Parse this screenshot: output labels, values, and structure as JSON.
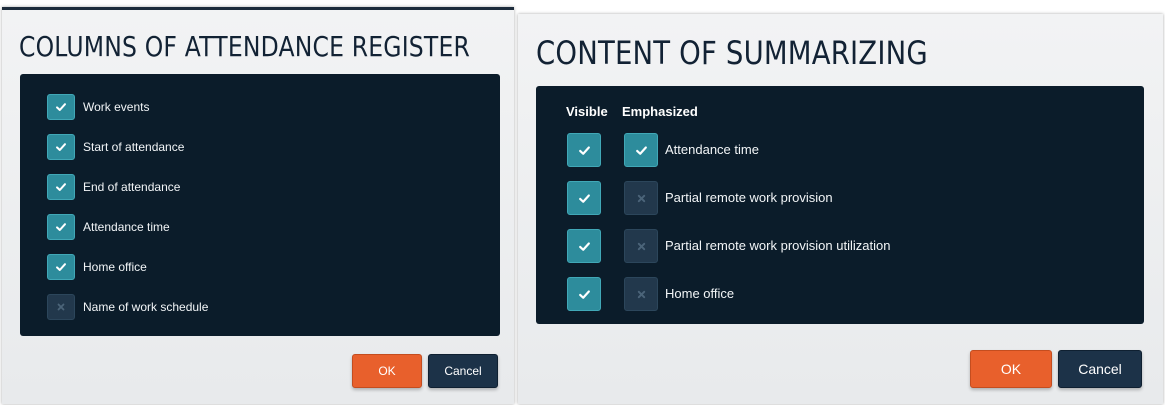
{
  "attendance_dialog": {
    "title": "COLUMNS OF ATTENDANCE REGISTER",
    "items": [
      {
        "label": "Work events",
        "checked": true
      },
      {
        "label": "Start of attendance",
        "checked": true
      },
      {
        "label": "End of attendance",
        "checked": true
      },
      {
        "label": "Attendance time",
        "checked": true
      },
      {
        "label": "Home office",
        "checked": true
      },
      {
        "label": "Name of work schedule",
        "checked": false
      }
    ],
    "ok_label": "OK",
    "cancel_label": "Cancel"
  },
  "summary_dialog": {
    "title": "CONTENT OF SUMMARIZING",
    "col_visible": "Visible",
    "col_emphasized": "Emphasized",
    "items": [
      {
        "label": "Attendance time",
        "visible": true,
        "emphasized": true
      },
      {
        "label": "Partial remote work provision",
        "visible": true,
        "emphasized": false
      },
      {
        "label": "Partial remote work provision utilization",
        "visible": true,
        "emphasized": false
      },
      {
        "label": "Home office",
        "visible": true,
        "emphasized": false
      }
    ],
    "ok_label": "OK",
    "cancel_label": "Cancel"
  },
  "colors": {
    "panel_bg": "#0b1c2a",
    "check_on": "#2d8c9c",
    "check_off": "#22384c",
    "ok_button": "#e8602c",
    "cancel_button": "#1c3248",
    "title_text": "#122234"
  },
  "icons": {
    "checked": "check-icon",
    "unchecked": "x-icon"
  }
}
